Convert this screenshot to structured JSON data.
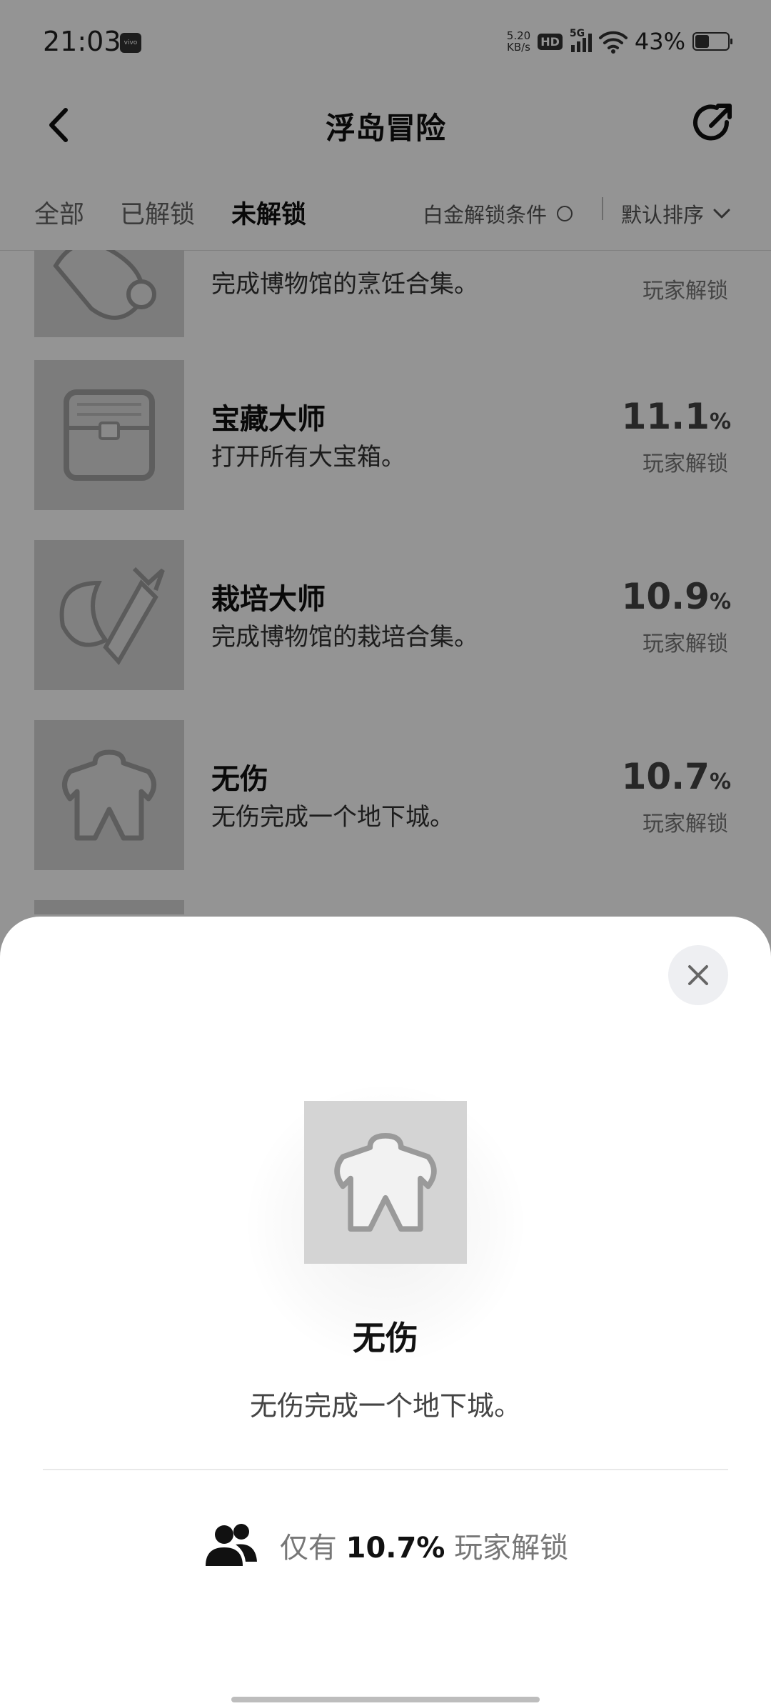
{
  "status_bar": {
    "time": "21:03",
    "vendor_badge": "vivo",
    "net_speed_value": "5.20",
    "net_speed_unit": "KB/s",
    "hd_label": "HD",
    "network_label": "5G",
    "battery": "43%",
    "battery_level": 0.43
  },
  "header": {
    "title": "浮岛冒险",
    "back_icon": "chevron-left-icon",
    "share_icon": "share-icon"
  },
  "tabs": {
    "items": [
      {
        "label": "全部"
      },
      {
        "label": "已解锁"
      },
      {
        "label": "未解锁"
      }
    ],
    "active_index": 2,
    "platinum_filter_label": "白金解锁条件",
    "sort_label": "默认排序"
  },
  "achievements": [
    {
      "name": "",
      "desc": "完成博物馆的烹饪合集。",
      "percent": "",
      "sub": "玩家解锁",
      "icon": "cooking-icon"
    },
    {
      "name": "宝藏大师",
      "desc": "打开所有大宝箱。",
      "percent": "11.1",
      "unit": "%",
      "sub": "玩家解锁",
      "icon": "treasure-chest-icon"
    },
    {
      "name": "栽培大师",
      "desc": "完成博物馆的栽培合集。",
      "percent": "10.9",
      "unit": "%",
      "sub": "玩家解锁",
      "icon": "plant-icon"
    },
    {
      "name": "无伤",
      "desc": "无伤完成一个地下城。",
      "percent": "10.7",
      "unit": "%",
      "sub": "玩家解锁",
      "icon": "armor-icon"
    }
  ],
  "sheet": {
    "name": "无伤",
    "desc": "无伤完成一个地下城。",
    "stat_prefix": "仅有",
    "stat_value": "10.7%",
    "stat_suffix": "玩家解锁",
    "icon": "armor-icon"
  },
  "colors": {
    "overlay": "#000000",
    "sheet_background": "#ffffff",
    "close_button_bg": "#eeeff2"
  }
}
